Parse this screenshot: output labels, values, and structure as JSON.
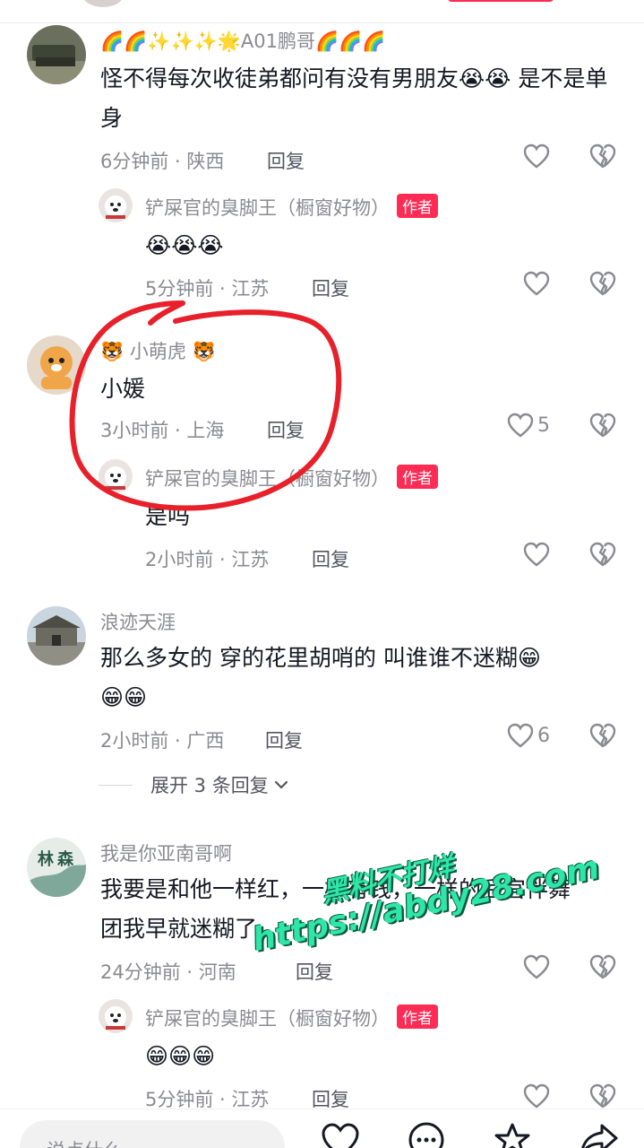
{
  "comments": [
    {
      "username": "🌈🌈✨✨✨🌟A01鹏哥🌈🌈🌈",
      "text": "怪不得每次收徒弟都问有没有男朋友😭😭 是不是单身",
      "time_location": "6分钟前 · 陕西",
      "reply": "回复",
      "likes": ""
    },
    {
      "username": "铲屎官的臭脚王（橱窗好物）",
      "badge": "作者",
      "text": "😭😭😭",
      "time_location": "5分钟前 · 江苏",
      "reply": "回复"
    },
    {
      "username": "🐯 小萌虎 🐯",
      "text": "小媛",
      "time_location": "3小时前 · 上海",
      "reply": "回复",
      "likes": "5"
    },
    {
      "username": "铲屎官的臭脚王（橱窗好物）",
      "badge": "作者",
      "text": "是吗",
      "time_location": "2小时前 · 江苏",
      "reply": "回复"
    },
    {
      "username": "浪迹天涯",
      "text_line1": "那么多女的  穿的花里胡哨的  叫谁谁不迷糊😁",
      "text_line2": "😁😁",
      "time_location": "2小时前 · 广西",
      "reply": "回复",
      "likes": "6",
      "expand": "展开 3 条回复"
    },
    {
      "username": "我是你亚南哥啊",
      "text_line1": "我要是和他一样红，一样有钱，一样的后宫伴舞",
      "text_line2": "团我早就迷糊了",
      "time_location": "24分钟前 · 河南",
      "reply": "回复"
    },
    {
      "username": "铲屎官的臭脚王（橱窗好物）",
      "badge": "作者",
      "text": "😁😁😁",
      "time_location": "5分钟前 · 江苏",
      "reply": "回复"
    }
  ],
  "watermark": {
    "line1": "黑料不打烊",
    "line2": "https://abdy28.com"
  },
  "bottom_bar": {
    "input_placeholder": "说点什么..."
  },
  "colors": {
    "accent": "#fe2c55",
    "annotation": "#e8202a",
    "watermark": "#2ee6a8"
  }
}
